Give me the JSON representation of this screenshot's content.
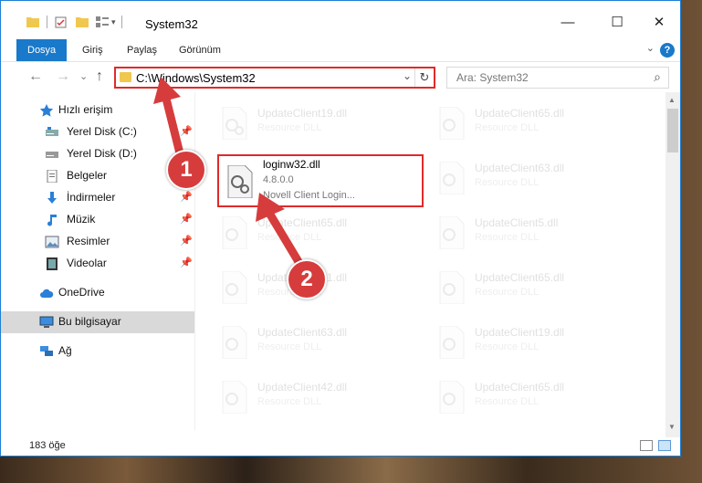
{
  "window": {
    "title": "System32",
    "minimize": "—",
    "maximize": "☐",
    "close": "✕"
  },
  "ribbon": {
    "tabs": [
      "Dosya",
      "Giriş",
      "Paylaş",
      "Görünüm"
    ],
    "help": "?",
    "collapse": "⌄"
  },
  "nav": {
    "back": "←",
    "forward": "→",
    "recent": "⌄",
    "up": "↑",
    "address": "C:\\Windows\\System32",
    "address_dropdown": "⌄",
    "refresh": "↻",
    "search_placeholder": "Ara: System32",
    "search_icon": "⌕"
  },
  "sidebar": {
    "items": [
      {
        "label": "Hızlı erişim",
        "icon": "star-icon",
        "pinned": false
      },
      {
        "label": "Yerel Disk (C:)",
        "icon": "drive-icon",
        "pinned": true
      },
      {
        "label": "Yerel Disk (D:)",
        "icon": "drive-icon",
        "pinned": false
      },
      {
        "label": "Belgeler",
        "icon": "document-icon",
        "pinned": false
      },
      {
        "label": "İndirmeler",
        "icon": "download-icon",
        "pinned": true
      },
      {
        "label": "Müzik",
        "icon": "music-icon",
        "pinned": true
      },
      {
        "label": "Resimler",
        "icon": "pictures-icon",
        "pinned": true
      },
      {
        "label": "Videolar",
        "icon": "video-icon",
        "pinned": true
      },
      {
        "label": "OneDrive",
        "icon": "cloud-icon",
        "pinned": false
      },
      {
        "label": "Bu bilgisayar",
        "icon": "computer-icon",
        "pinned": false,
        "selected": true
      },
      {
        "label": "Ağ",
        "icon": "network-icon",
        "pinned": false
      }
    ],
    "pin_glyph": "📌"
  },
  "files": {
    "highlighted": {
      "name": "loginw32.dll",
      "version": "4.8.0.0",
      "description": "Novell Client Login..."
    },
    "left_column": [
      {
        "name": "UpdateClient19.dll",
        "type": "Resource DLL"
      },
      {
        "name": "UpdateClient65.dll",
        "type": "Resource DLL"
      },
      {
        "name": "UpdateClient21.dll",
        "type": "Resource DLL"
      },
      {
        "name": "UpdateClient63.dll",
        "type": "Resource DLL"
      },
      {
        "name": "UpdateClient42.dll",
        "type": "Resource DLL"
      }
    ],
    "right_column": [
      {
        "name": "UpdateClient65.dll",
        "type": "Resource DLL"
      },
      {
        "name": "UpdateClient63.dll",
        "type": "Resource DLL"
      },
      {
        "name": "UpdateClient5.dll",
        "type": "Resource DLL"
      },
      {
        "name": "UpdateClient65.dll",
        "type": "Resource DLL"
      },
      {
        "name": "UpdateClient19.dll",
        "type": "Resource DLL"
      },
      {
        "name": "UpdateClient65.dll",
        "type": "Resource DLL"
      }
    ]
  },
  "status": {
    "count": "183 öğe"
  },
  "annotations": {
    "step1": "1",
    "step2": "2",
    "color": "#d63c3c"
  }
}
